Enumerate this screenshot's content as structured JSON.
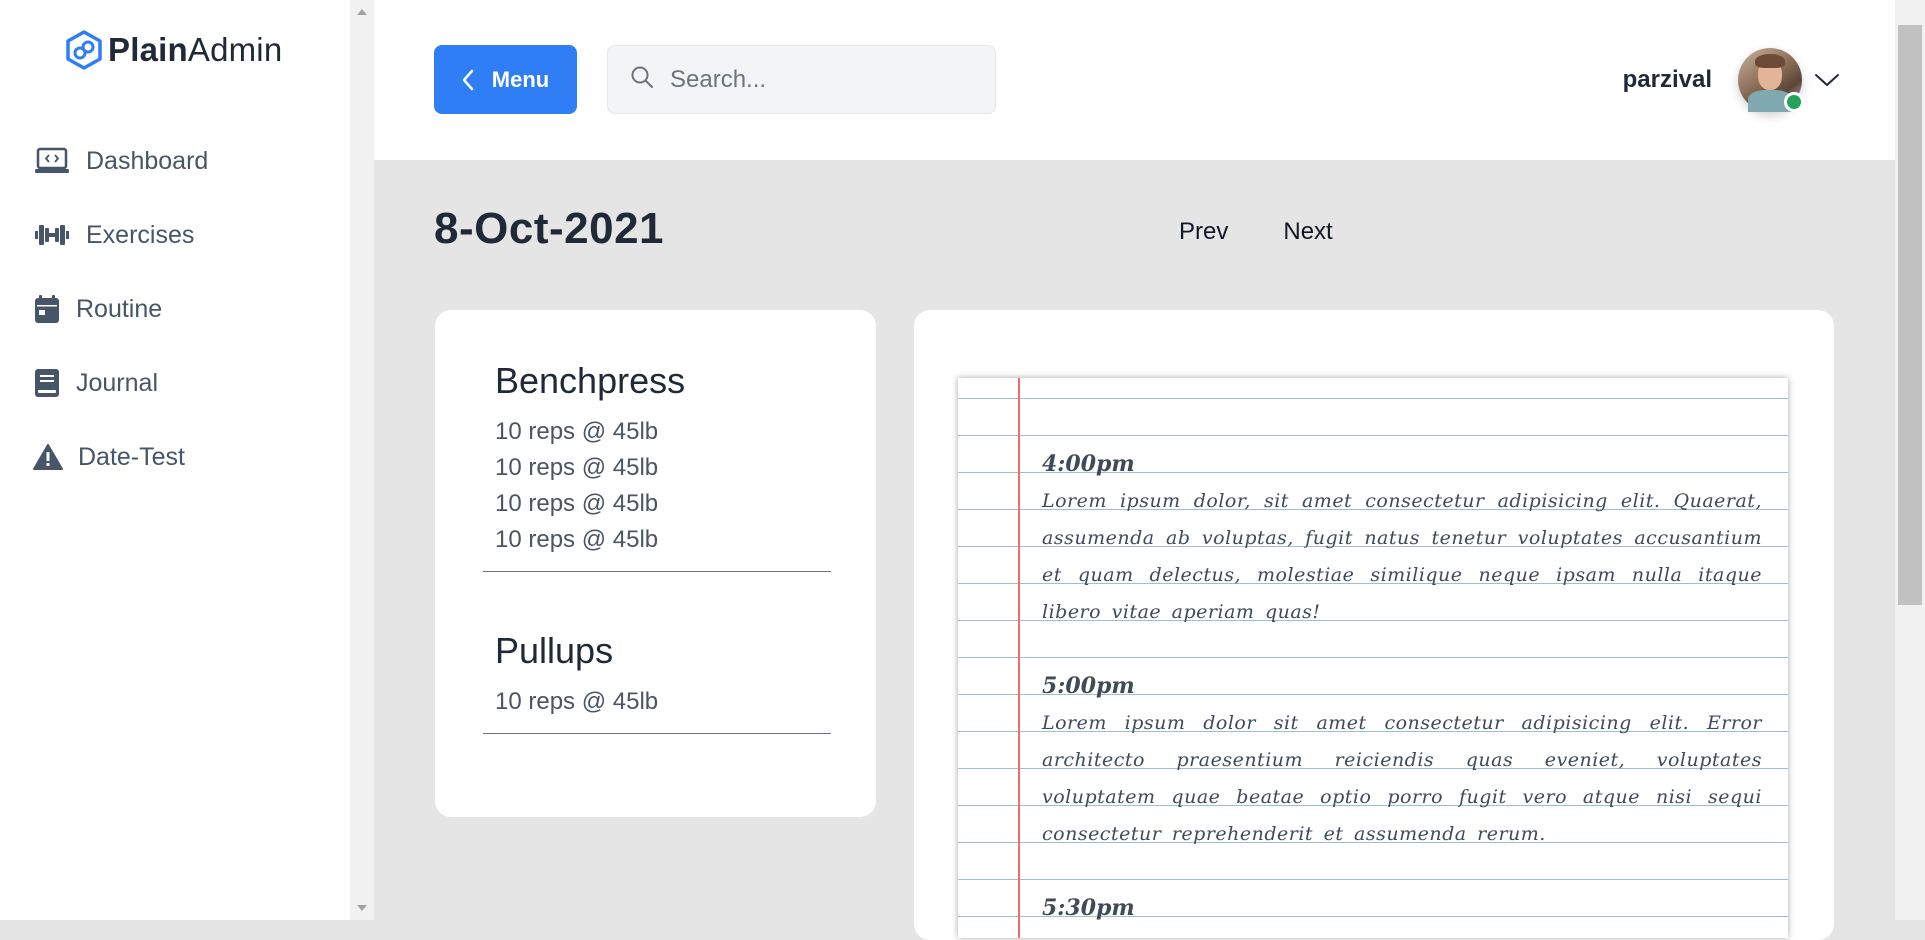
{
  "app": {
    "logo_bold": "Plain",
    "logo_light": "Admin"
  },
  "sidebar": {
    "items": [
      {
        "label": "Dashboard",
        "icon": "laptop-code-icon"
      },
      {
        "label": "Exercises",
        "icon": "dumbbell-icon"
      },
      {
        "label": "Routine",
        "icon": "calendar-icon"
      },
      {
        "label": "Journal",
        "icon": "book-icon"
      },
      {
        "label": "Date-Test",
        "icon": "warning-icon"
      }
    ]
  },
  "header": {
    "menu_label": "Menu",
    "search_placeholder": "Search...",
    "username": "parzival"
  },
  "main": {
    "date_title": "8-Oct-2021",
    "prev_label": "Prev",
    "next_label": "Next"
  },
  "exercises": [
    {
      "name": "Benchpress",
      "sets": [
        "10 reps @ 45lb",
        "10 reps @ 45lb",
        "10 reps @ 45lb",
        "10 reps @ 45lb"
      ]
    },
    {
      "name": "Pullups",
      "sets": [
        "10 reps @ 45lb"
      ]
    }
  ],
  "journal": {
    "entries": [
      {
        "time": "4:00pm",
        "text": "Lorem ipsum dolor, sit amet consectetur adipisicing elit. Quaerat, assumenda ab voluptas, fugit natus tenetur voluptates accusantium et quam delectus, molestiae similique neque ipsam nulla itaque libero vitae aperiam quas!"
      },
      {
        "time": "5:00pm",
        "text": "Lorem ipsum dolor sit amet consectetur adipisicing elit. Error architecto praesentium reiciendis quas eveniet, voluptates voluptatem quae beatae optio porro fugit vero atque nisi sequi consectetur reprehenderit et assumenda rerum."
      },
      {
        "time": "5:30pm",
        "text": ""
      }
    ]
  },
  "colors": {
    "accent": "#2f7ef5",
    "online_status": "#22a35a",
    "margin_line": "#f26b6b",
    "ruled_line": "#9ec0cc"
  }
}
